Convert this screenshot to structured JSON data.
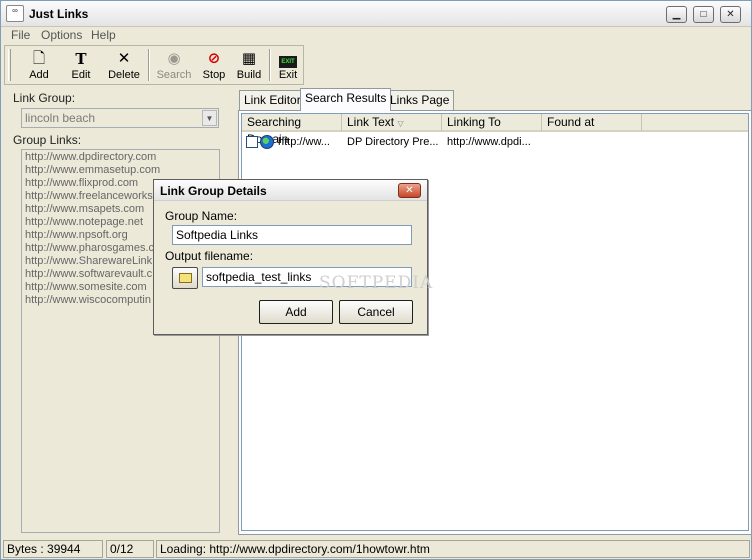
{
  "window": {
    "title": "Just Links",
    "icon_text": "Links"
  },
  "menu": [
    "File",
    "Options",
    "Help"
  ],
  "toolbar": {
    "add": "Add",
    "edit": "Edit",
    "delete": "Delete",
    "search": "Search",
    "stop": "Stop",
    "build": "Build",
    "exit": "Exit"
  },
  "left": {
    "link_group_label": "Link Group:",
    "link_group_value": "lincoln beach",
    "group_links_label": "Group Links:",
    "group_links": [
      "http://www.dpdirectory.com",
      "http://www.emmasetup.com",
      "http://www.flixprod.com",
      "http://www.freelanceworks",
      "http://www.msapets.com",
      "http://www.notepage.net",
      "http://www.npsoft.org",
      "http://www.pharosgames.c",
      "http://www.SharewareLink",
      "http://www.softwarevault.c",
      "http://www.somesite.com",
      "http://www.wiscocomputin"
    ]
  },
  "tabs": [
    "Link Editor",
    "Search Results",
    "Links Page"
  ],
  "results": {
    "columns": [
      "Searching Domain",
      "Link Text",
      "Linking To",
      "Found at"
    ],
    "rows": [
      {
        "domain": "http://ww...",
        "link_text": "DP Directory Pre...",
        "linking_to": "http://www.dpdi...",
        "found_at": ""
      }
    ]
  },
  "status": {
    "bytes": "Bytes : 39944",
    "progress": "0/12",
    "loading": "Loading: http://www.dpdirectory.com/1howtowr.htm"
  },
  "dialog": {
    "title": "Link Group Details",
    "group_name_label": "Group Name:",
    "group_name_value": "Softpedia Links",
    "output_label": "Output filename:",
    "output_value": "softpedia_test_links",
    "add_button": "Add",
    "cancel_button": "Cancel",
    "watermark": "SOFTPEDIA"
  }
}
